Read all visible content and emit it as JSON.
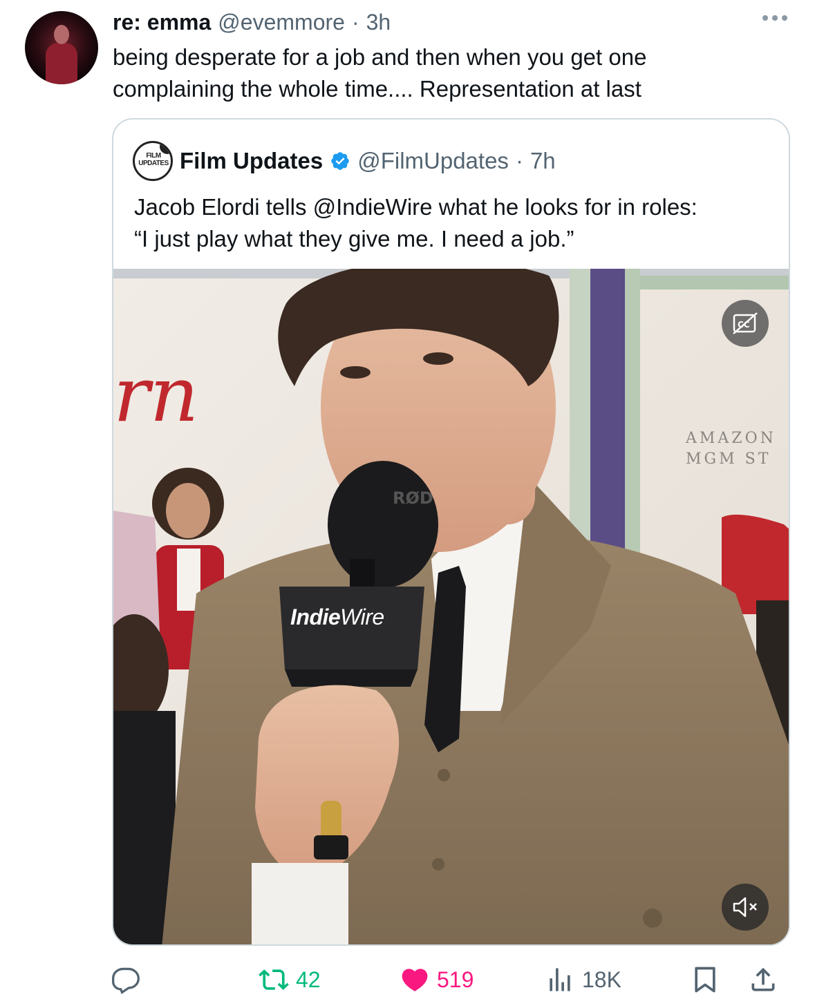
{
  "tweet": {
    "display_name": "re: emma",
    "handle": "@evemmore",
    "separator": "·",
    "time": "3h",
    "text": "being desperate for a job and then when you get one\ncomplaining the whole time.... Representation at last"
  },
  "quoted_tweet": {
    "display_name": "Film Updates",
    "avatar_text": "FILM\nUPDATES",
    "handle": "@FilmUpdates",
    "separator": "·",
    "time": "7h",
    "text": "Jacob Elordi tells @IndieWire what he looks for in roles:\n“I just play what they give me. I need a job.”",
    "media": {
      "backdrop_letters_left": "rn",
      "backdrop_sign_right": "AMAZON\nMGM ST",
      "mic_flag_top": "RØD",
      "mic_flag_brand_bold": "Indie",
      "mic_flag_brand_light": "Wire"
    }
  },
  "actions": {
    "retweets": "42",
    "likes": "519",
    "views": "18K"
  },
  "colors": {
    "verified": "#1d9bf0",
    "retweet": "#00ba7c",
    "like": "#f91880",
    "secondary_text": "#536471"
  }
}
